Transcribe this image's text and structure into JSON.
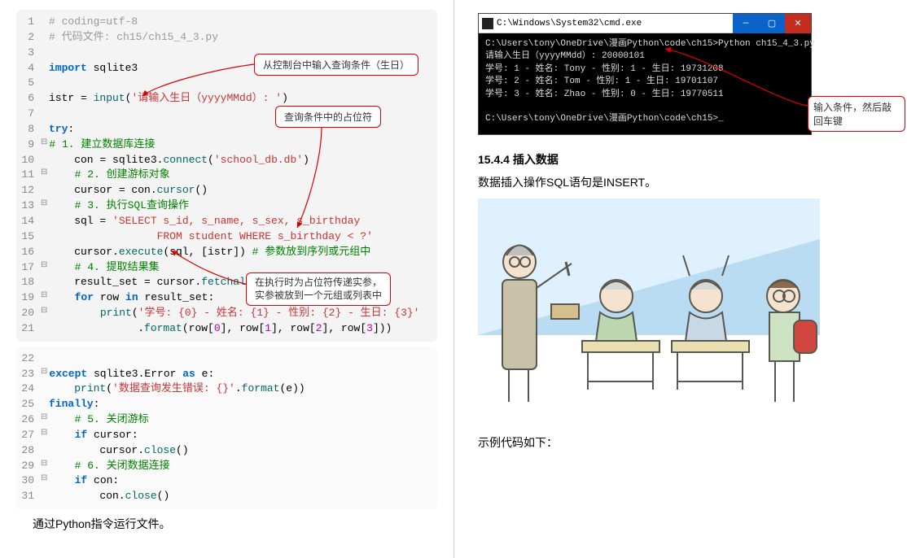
{
  "left": {
    "code1": [
      {
        "n": "1",
        "t": "# coding=utf-8",
        "cls": "c-comment"
      },
      {
        "n": "2",
        "t": "# 代码文件: ch15/ch15_4_3.py",
        "cls": "c-comment"
      },
      {
        "n": "3",
        "t": ""
      },
      {
        "n": "4",
        "html": "<span class='c-keyword'>import</span> sqlite3"
      },
      {
        "n": "5",
        "t": ""
      },
      {
        "n": "6",
        "html": "istr = <span class='c-func'>input</span>(<span class='c-string'>'请输入生日（yyyyMMdd）: '</span>)"
      },
      {
        "n": "7",
        "t": ""
      },
      {
        "n": "8",
        "html": "<span class='c-keyword'>try</span>:"
      },
      {
        "n": "9",
        "fold": true,
        "html": "<span class='c-green'># 1. 建立数据库连接</span>"
      },
      {
        "n": "10",
        "html": "    con = sqlite3.<span class='c-func'>connect</span>(<span class='c-string'>'school_db.db'</span>)"
      },
      {
        "n": "11",
        "fold": true,
        "html": "    <span class='c-green'># 2. 创建游标对象</span>"
      },
      {
        "n": "12",
        "html": "    cursor = con.<span class='c-func'>cursor</span>()"
      },
      {
        "n": "13",
        "fold": true,
        "html": "    <span class='c-green'># 3. 执行SQL查询操作</span>"
      },
      {
        "n": "14",
        "html": "    sql = <span class='c-string'>'SELECT s_id, s_name, s_sex, s_birthday</span>"
      },
      {
        "n": "15",
        "html": "                 <span class='c-string'>FROM student WHERE s_birthday &lt; ?'</span>"
      },
      {
        "n": "16",
        "html": "    cursor.<span class='c-func'>execute</span>(sql, [istr]) <span class='c-green'># 参数放到序列或元组中</span>"
      },
      {
        "n": "17",
        "fold": true,
        "html": "    <span class='c-green'># 4. 提取结果集</span>"
      },
      {
        "n": "18",
        "html": "    result_set = cursor.<span class='c-func'>fetchall</span>()"
      },
      {
        "n": "19",
        "fold": true,
        "html": "    <span class='c-keyword'>for</span> row <span class='c-keyword'>in</span> result_set:"
      },
      {
        "n": "20",
        "fold": true,
        "html": "        <span class='c-func'>print</span>(<span class='c-string'>'学号: {0} - 姓名: {1} - 性别: {2} - 生日: {3}'</span>"
      },
      {
        "n": "21",
        "html": "              .<span class='c-func'>format</span>(row[<span class='c-sql'>0</span>], row[<span class='c-sql'>1</span>], row[<span class='c-sql'>2</span>], row[<span class='c-sql'>3</span>]))"
      }
    ],
    "code2": [
      {
        "n": "22",
        "t": ""
      },
      {
        "n": "23",
        "fold": true,
        "html": "<span class='c-keyword'>except</span> sqlite3.Error <span class='c-keyword'>as</span> e:"
      },
      {
        "n": "24",
        "html": "    <span class='c-func'>print</span>(<span class='c-string'>'数据查询发生错误: {}'</span>.<span class='c-func'>format</span>(e))"
      },
      {
        "n": "25",
        "html": "<span class='c-keyword'>finally</span>:"
      },
      {
        "n": "26",
        "fold": true,
        "html": "    <span class='c-green'># 5. 关闭游标</span>"
      },
      {
        "n": "27",
        "fold": true,
        "html": "    <span class='c-keyword'>if</span> cursor:"
      },
      {
        "n": "28",
        "html": "        cursor.<span class='c-func'>close</span>()"
      },
      {
        "n": "29",
        "fold": true,
        "html": "    <span class='c-green'># 6. 关闭数据连接</span>"
      },
      {
        "n": "30",
        "fold": true,
        "html": "    <span class='c-keyword'>if</span> con:"
      },
      {
        "n": "31",
        "html": "        con.<span class='c-func'>close</span>()"
      }
    ],
    "callout1": "从控制台中输入查询条件（生日）",
    "callout2": "查询条件中的占位符",
    "callout3a": "在执行时为占位符传递实参，",
    "callout3b": "实参被放到一个元组或列表中",
    "caption": "通过Python指令运行文件。"
  },
  "right": {
    "term_title": "C:\\Windows\\System32\\cmd.exe",
    "term_lines": [
      "C:\\Users\\tony\\OneDrive\\漫画Python\\code\\ch15>Python ch15_4_3.py",
      "请输入生日（yyyyMMdd）: 20000101",
      "学号: 1 - 姓名: Tony - 性别: 1 - 生日: 19731208",
      "学号: 2 - 姓名: Tom - 性别: 1 - 生日: 19701107",
      "学号: 3 - 姓名: Zhao - 性别: 0 - 生日: 19770511",
      "",
      "C:\\Users\\tony\\OneDrive\\漫画Python\\code\\ch15>_"
    ],
    "term_callout": "输入条件，然后敲回车键",
    "section_title": "15.4.4 插入数据",
    "section_text": "数据插入操作SQL语句是INSERT。",
    "caption2": "示例代码如下："
  },
  "colors": {
    "callout_border": "#d00",
    "term_blue": "#0a63c9",
    "term_close": "#c42c1d"
  }
}
